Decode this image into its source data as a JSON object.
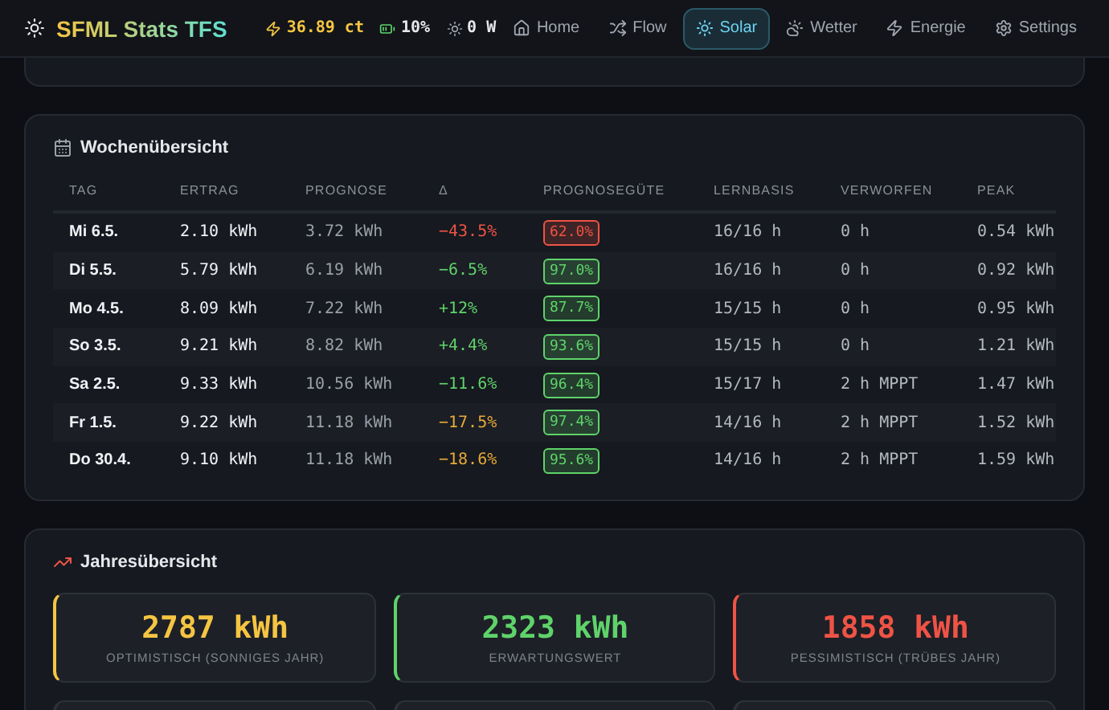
{
  "header": {
    "title": "SFML Stats TFS",
    "stats": [
      {
        "kind": "price",
        "value": "36.89 ct"
      },
      {
        "kind": "battery",
        "value": "10%"
      },
      {
        "kind": "power",
        "value": "0 W"
      }
    ],
    "nav": [
      {
        "label": "Home",
        "selected": false
      },
      {
        "label": "Flow",
        "selected": false
      },
      {
        "label": "Solar",
        "selected": true
      },
      {
        "label": "Wetter",
        "selected": false
      },
      {
        "label": "Energie",
        "selected": false
      },
      {
        "label": "Settings",
        "selected": false
      }
    ]
  },
  "weekly": {
    "title": "Wochenübersicht",
    "columns": [
      "TAG",
      "ERTRAG",
      "PROGNOSE",
      "Δ",
      "PROGNOSEGÜTE",
      "LERNBASIS",
      "VERWORFEN",
      "PEAK"
    ],
    "rows": [
      {
        "day": "Mi 6.5.",
        "yield": "2.10 kWh",
        "forecast": "3.72 kWh",
        "delta": {
          "text": "−43.5%",
          "color": "#ef5345"
        },
        "quality": {
          "text": "62.0%",
          "color": "#ef5345"
        },
        "basis": "16/16 h",
        "discarded": "0 h",
        "peak": "0.54 kWh"
      },
      {
        "day": "Di 5.5.",
        "yield": "5.79 kWh",
        "forecast": "6.19 kWh",
        "delta": {
          "text": "−6.5%",
          "color": "#5fd36a"
        },
        "quality": {
          "text": "97.0%",
          "color": "#5fd36a"
        },
        "basis": "16/16 h",
        "discarded": "0 h",
        "peak": "0.92 kWh"
      },
      {
        "day": "Mo 4.5.",
        "yield": "8.09 kWh",
        "forecast": "7.22 kWh",
        "delta": {
          "text": "+12%",
          "color": "#5fd36a"
        },
        "quality": {
          "text": "87.7%",
          "color": "#5fd36a"
        },
        "basis": "15/15 h",
        "discarded": "0 h",
        "peak": "0.95 kWh"
      },
      {
        "day": "So 3.5.",
        "yield": "9.21 kWh",
        "forecast": "8.82 kWh",
        "delta": {
          "text": "+4.4%",
          "color": "#5fd36a"
        },
        "quality": {
          "text": "93.6%",
          "color": "#5fd36a"
        },
        "basis": "15/15 h",
        "discarded": "0 h",
        "peak": "1.21 kWh"
      },
      {
        "day": "Sa 2.5.",
        "yield": "9.33 kWh",
        "forecast": "10.56 kWh",
        "delta": {
          "text": "−11.6%",
          "color": "#5fd36a"
        },
        "quality": {
          "text": "96.4%",
          "color": "#5fd36a"
        },
        "basis": "15/17 h",
        "discarded": "2 h MPPT",
        "peak": "1.47 kWh"
      },
      {
        "day": "Fr 1.5.",
        "yield": "9.22 kWh",
        "forecast": "11.18 kWh",
        "delta": {
          "text": "−17.5%",
          "color": "#e8a93a"
        },
        "quality": {
          "text": "97.4%",
          "color": "#5fd36a"
        },
        "basis": "14/16 h",
        "discarded": "2 h MPPT",
        "peak": "1.52 kWh"
      },
      {
        "day": "Do 30.4.",
        "yield": "9.10 kWh",
        "forecast": "11.18 kWh",
        "delta": {
          "text": "−18.6%",
          "color": "#e8a93a"
        },
        "quality": {
          "text": "95.6%",
          "color": "#5fd36a"
        },
        "basis": "14/16 h",
        "discarded": "2 h MPPT",
        "peak": "1.59 kWh"
      }
    ]
  },
  "yearly": {
    "title": "Jahresübersicht",
    "cards": [
      {
        "value": "2787 kWh",
        "label": "OPTIMISTISCH (SONNIGES JAHR)",
        "color": "#f5c542"
      },
      {
        "value": "2323 kWh",
        "label": "ERWARTUNGSWERT",
        "color": "#5fd36a"
      },
      {
        "value": "1858 kWh",
        "label": "PESSIMISTISCH (TRÜBES JAHR)",
        "color": "#ef5345"
      }
    ]
  }
}
